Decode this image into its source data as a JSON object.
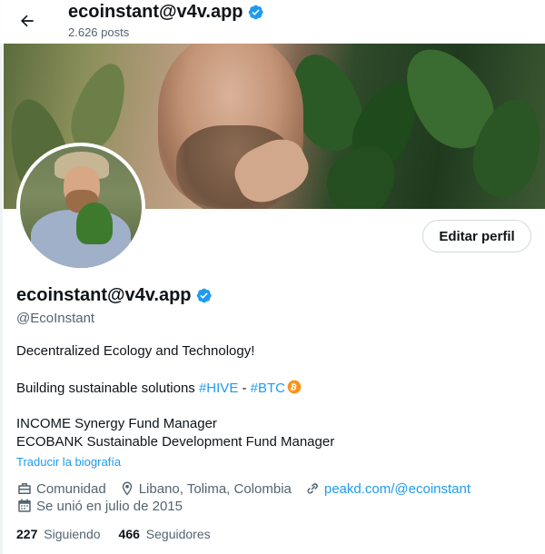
{
  "header": {
    "title": "ecoinstant@v4v.app",
    "posts": "2.626 posts"
  },
  "profile": {
    "display_name": "ecoinstant@v4v.app",
    "handle": "@EcoInstant",
    "edit_label": "Editar perfil"
  },
  "bio": {
    "line1": "Decentralized Ecology and Technology!",
    "line2_prefix": "Building sustainable solutions ",
    "hashtag_hive": "#HIVE",
    "separator": " - ",
    "hashtag_btc": "#BTC",
    "line3": "INCOME Synergy Fund Manager",
    "line4": "ECOBANK Sustainable Development Fund Manager",
    "translate": "Traducir la biografía"
  },
  "meta": {
    "category": "Comunidad",
    "location": "Libano, Tolima, Colombia",
    "website": "peakd.com/@ecoinstant",
    "joined": "Se unió en julio de 2015"
  },
  "stats": {
    "following_count": "227",
    "following_label": "Siguiendo",
    "followers_count": "466",
    "followers_label": "Seguidores"
  },
  "icons": {
    "back": "arrow-left-icon",
    "verified": "verified-badge-icon",
    "bitcoin": "bitcoin-icon",
    "category": "briefcase-icon",
    "location": "location-pin-icon",
    "website": "link-icon",
    "joined": "calendar-icon"
  },
  "colors": {
    "accent": "#1d9bf0",
    "muted": "#536471",
    "text": "#0f1419",
    "bitcoin": "#f7931a"
  }
}
